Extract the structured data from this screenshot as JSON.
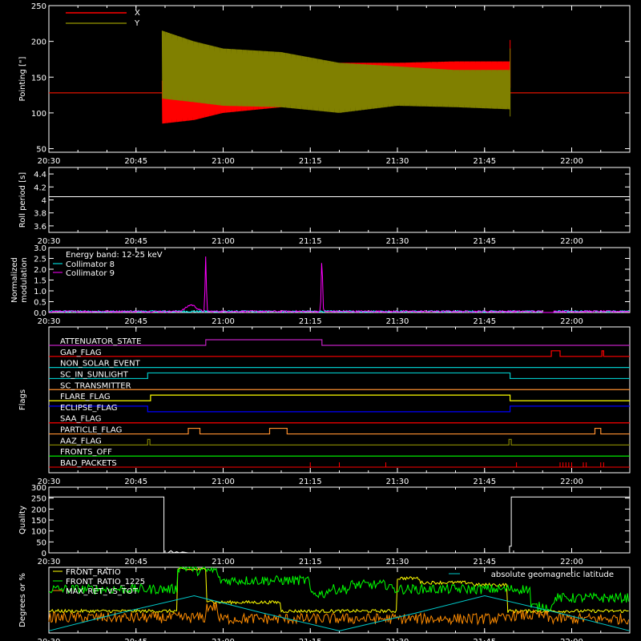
{
  "figure": {
    "background": "#000000",
    "foreground": "#ffffff",
    "time_ticks": [
      "20:30",
      "20:45",
      "21:00",
      "21:15",
      "21:30",
      "21:45",
      "22:00"
    ],
    "time_tick_minutes": [
      0,
      15,
      30,
      45,
      60,
      75,
      90
    ],
    "time_range_minutes": [
      0,
      100
    ]
  },
  "chart_data": [
    {
      "id": "pointing",
      "type": "line",
      "ylabel": "Pointing [\"]",
      "ylim": [
        45,
        250
      ],
      "yticks": [
        50,
        100,
        150,
        200,
        250
      ],
      "legend_position": "top-left",
      "series": [
        {
          "name": "X",
          "color": "#ff0000",
          "mean": 128,
          "active_range_minutes": [
            19.5,
            79.4
          ],
          "envelope_minutes": [
            19.5,
            25,
            30,
            40,
            50,
            60,
            70,
            79.4
          ],
          "envelope_low": [
            85,
            90,
            100,
            108,
            130,
            140,
            145,
            145
          ],
          "envelope_high": [
            145,
            150,
            160,
            165,
            170,
            170,
            172,
            172
          ]
        },
        {
          "name": "Y",
          "color": "#808000",
          "mean": 128,
          "active_range_minutes": [
            19.5,
            79.4
          ],
          "envelope_minutes": [
            19.5,
            25,
            30,
            40,
            50,
            60,
            70,
            79.4
          ],
          "envelope_low": [
            120,
            115,
            110,
            108,
            100,
            110,
            108,
            105
          ],
          "envelope_high": [
            215,
            200,
            190,
            185,
            170,
            165,
            160,
            160
          ]
        }
      ]
    },
    {
      "id": "roll_period",
      "type": "line",
      "ylabel": "Roll period [s]",
      "ylim": [
        3.5,
        4.5
      ],
      "yticks": [
        3.6,
        3.8,
        4.0,
        4.2,
        4.4
      ],
      "series": [
        {
          "color": "#ffffff",
          "value": 4.05
        }
      ]
    },
    {
      "id": "modulation",
      "type": "line",
      "ylabel": "Normalized modulation",
      "ylim": [
        0,
        3
      ],
      "yticks": [
        0.0,
        0.5,
        1.0,
        1.5,
        2.0,
        2.5,
        3.0
      ],
      "ytick_labels": [
        "0.0",
        "0.5",
        "1.0",
        "1.5",
        "2.0",
        "2.5",
        "3.0"
      ],
      "legend_title": "Energy band: 12-25 keV",
      "legend_position": "top-left",
      "series": [
        {
          "name": "Collimator 8",
          "color": "#00ffff",
          "baseline": 0.05
        },
        {
          "name": "Collimator 9",
          "color": "#ff00ff",
          "baseline": 0.05,
          "peaks": [
            {
              "x": 24.5,
              "y": 0.3
            },
            {
              "x": 27,
              "y": 2.5
            },
            {
              "x": 47,
              "y": 2.5
            }
          ]
        }
      ]
    },
    {
      "id": "flags",
      "type": "line",
      "ylabel": "Flags",
      "series": [
        {
          "name": "ATTENUATOR_STATE",
          "color": "#c020c0",
          "on_intervals": [
            [
              27,
              47
            ]
          ]
        },
        {
          "name": "GAP_FLAG",
          "color": "#ff0000",
          "on_intervals": [
            [
              86.5,
              88
            ],
            [
              95.2,
              95.5
            ]
          ]
        },
        {
          "name": "NON_SOLAR_EVENT",
          "color": "#00c8c8",
          "on_intervals": []
        },
        {
          "name": "SC_IN_SUNLIGHT",
          "color": "#00c8c8",
          "on_intervals": [
            [
              17,
              79.4
            ]
          ]
        },
        {
          "name": "SC_TRANSMITTER",
          "color": "#ff9030",
          "on_intervals": []
        },
        {
          "name": "FLARE_FLAG",
          "color": "#ffff00",
          "on_intervals": [
            [
              17.5,
              79.4
            ]
          ]
        },
        {
          "name": "ECLIPSE_FLAG",
          "color": "#0000ff",
          "on_intervals": [
            [
              0,
              17
            ],
            [
              79.4,
              100
            ]
          ],
          "low_intervals": [
            [
              17,
              79.4
            ]
          ]
        },
        {
          "name": "SAA_FLAG",
          "color": "#ff0000",
          "on_intervals": []
        },
        {
          "name": "PARTICLE_FLAG",
          "color": "#ff9030",
          "on_intervals": [
            [
              24,
              26
            ],
            [
              38,
              41
            ],
            [
              94,
              95
            ]
          ]
        },
        {
          "name": "AAZ_FLAG",
          "color": "#808000",
          "on_intervals": [
            [
              17,
              17.4
            ],
            [
              79.2,
              79.6
            ]
          ]
        },
        {
          "name": "FRONTS_OFF",
          "color": "#00ff00",
          "on_intervals": []
        },
        {
          "name": "BAD_PACKETS",
          "color": "#ff0000",
          "spikes": [
            45,
            50,
            58,
            80.5,
            88,
            88.5,
            89,
            89.5,
            90,
            92,
            92.5,
            95,
            95.5
          ]
        }
      ]
    },
    {
      "id": "quality",
      "type": "line",
      "ylabel": "Quality",
      "ylim": [
        0,
        300
      ],
      "yticks": [
        0,
        50,
        100,
        150,
        200,
        250,
        300
      ],
      "series": [
        {
          "color": "#ffffff",
          "x": [
            0,
            19.8,
            19.8,
            20.5,
            21,
            21.5,
            22,
            22.5,
            23,
            24,
            79.3,
            79.3,
            79.6,
            79.6,
            100
          ],
          "y": [
            255,
            255,
            0,
            0,
            10,
            0,
            5,
            0,
            4,
            0,
            0,
            30,
            30,
            255,
            255
          ]
        }
      ]
    },
    {
      "id": "ratios",
      "type": "line",
      "ylabel": "Degrees or %",
      "ylim": [
        0,
        60
      ],
      "series": [
        {
          "name": "FRONT_RATIO",
          "color": "#ffff00",
          "legend_position": "top-left",
          "base": 20,
          "segments": [
            [
              0,
              22,
              20
            ],
            [
              22,
              27,
              58
            ],
            [
              27,
              28,
              30
            ],
            [
              28,
              40,
              28
            ],
            [
              40,
              60,
              20
            ],
            [
              60,
              64,
              50
            ],
            [
              64,
              73,
              46
            ],
            [
              73,
              79,
              44
            ],
            [
              79,
              100,
              20
            ]
          ]
        },
        {
          "name": "FRONT_RATIO_1225",
          "color": "#00ff00",
          "legend_position": "top-left",
          "base": 40,
          "segments": [
            [
              0,
              22,
              40
            ],
            [
              22,
              25,
              60
            ],
            [
              25,
              29,
              57
            ],
            [
              29,
              45,
              48
            ],
            [
              45,
              48,
              36
            ],
            [
              48,
              52,
              40
            ],
            [
              52,
              59,
              44
            ],
            [
              59,
              79,
              40
            ],
            [
              79,
              83,
              40
            ],
            [
              83,
              87,
              24
            ],
            [
              87,
              100,
              32
            ]
          ]
        },
        {
          "name": "MAX_RET_VS_TOT",
          "color": "#ff8c00",
          "legend_position": "top-left",
          "base": 14,
          "segments": [
            [
              0,
              27,
              14
            ],
            [
              27,
              29,
              24
            ],
            [
              29,
              79,
              13
            ],
            [
              79,
              86,
              16
            ],
            [
              86,
              100,
              13
            ]
          ]
        },
        {
          "name": "absolute geomagnetic latitude",
          "color": "#00c8c8",
          "legend_position": "top-right",
          "x": [
            0,
            12,
            25,
            37,
            50,
            63,
            75,
            88,
            100
          ],
          "y": [
            2,
            18,
            34,
            18,
            2,
            18,
            34,
            18,
            2
          ]
        }
      ]
    }
  ]
}
